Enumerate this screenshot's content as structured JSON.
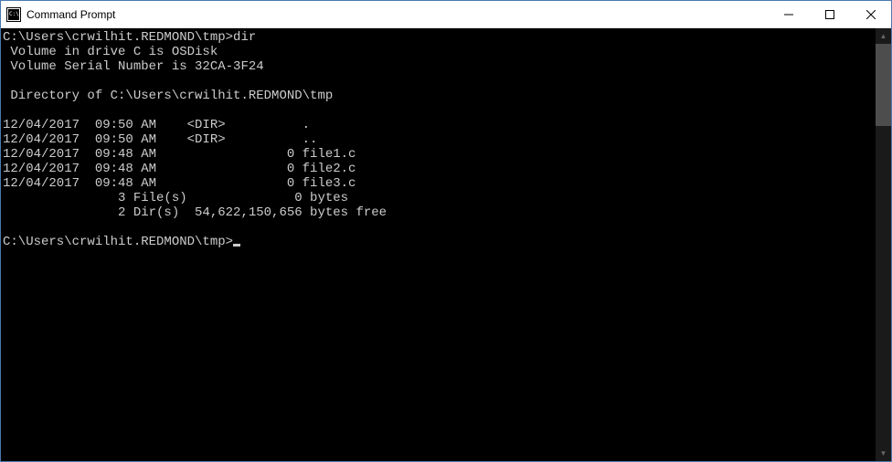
{
  "window": {
    "title": "Command Prompt"
  },
  "terminal": {
    "prompt1": "C:\\Users\\crwilhit.REDMOND\\tmp>",
    "command1": "dir",
    "lines": [
      " Volume in drive C is OSDisk",
      " Volume Serial Number is 32CA-3F24",
      "",
      " Directory of C:\\Users\\crwilhit.REDMOND\\tmp",
      "",
      "12/04/2017  09:50 AM    <DIR>          .",
      "12/04/2017  09:50 AM    <DIR>          ..",
      "12/04/2017  09:48 AM                 0 file1.c",
      "12/04/2017  09:48 AM                 0 file2.c",
      "12/04/2017  09:48 AM                 0 file3.c",
      "               3 File(s)              0 bytes",
      "               2 Dir(s)  54,622,150,656 bytes free",
      ""
    ],
    "prompt2": "C:\\Users\\crwilhit.REDMOND\\tmp>"
  }
}
